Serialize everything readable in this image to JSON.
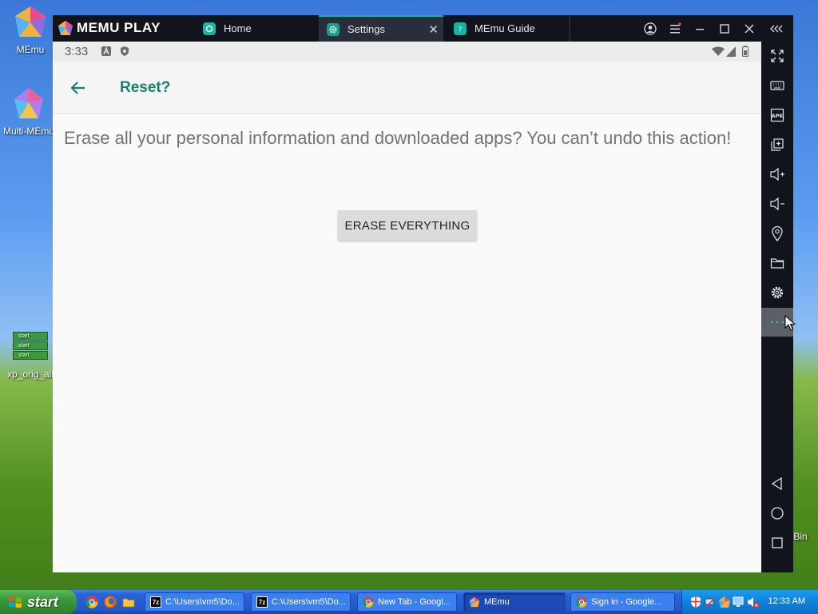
{
  "desktop": {
    "icons": [
      {
        "label": "MEmu"
      },
      {
        "label": "Multi-MEmu"
      },
      {
        "label": "xp_orig_all"
      },
      {
        "label": "Bin"
      }
    ],
    "mini_start_label": "start"
  },
  "emulator": {
    "brand": "MEMU PLAY",
    "tabs": [
      {
        "label": "Home",
        "icon": "home-app-icon"
      },
      {
        "label": "Settings",
        "icon": "settings-app-icon",
        "active": true
      },
      {
        "label": "MEmu Guide",
        "icon": "help-app-icon"
      }
    ],
    "accent_color": "#17b3a4",
    "window_controls": [
      "account-icon",
      "menu-icon",
      "minimize-icon",
      "maximize-icon",
      "close-icon",
      "collapse-sidebar-icon"
    ],
    "sidebar": [
      "fullscreen-icon",
      "keyboard-icon",
      "apk-icon",
      "multi-window-icon",
      "volume-up-icon",
      "volume-down-icon",
      "location-icon",
      "folder-icon",
      "gear-icon",
      "more-icon",
      "nav-back-icon",
      "nav-home-icon",
      "nav-recents-icon"
    ],
    "apk_label": "APK"
  },
  "android": {
    "status": {
      "time": "3:33"
    },
    "appbar": {
      "title": "Reset?"
    },
    "body": {
      "message": "Erase all your personal information and downloaded apps? You can’t undo this action!",
      "erase_button": "ERASE EVERYTHING"
    },
    "title_color": "#167f72"
  },
  "taskbar": {
    "start_label": "start",
    "buttons": [
      {
        "label": "C:\\Users\\vm5\\Do...",
        "icon": "7z-icon"
      },
      {
        "label": "C:\\Users\\vm5\\Do...",
        "icon": "7z-icon"
      },
      {
        "label": "New Tab - Googl...",
        "icon": "chrome-icon"
      },
      {
        "label": "MEmu",
        "icon": "memu-icon",
        "active": true
      },
      {
        "label": "Sign in - Google...",
        "icon": "chrome-icon"
      }
    ],
    "icon_7z_text": "7z",
    "clock": "12:33 AM"
  }
}
